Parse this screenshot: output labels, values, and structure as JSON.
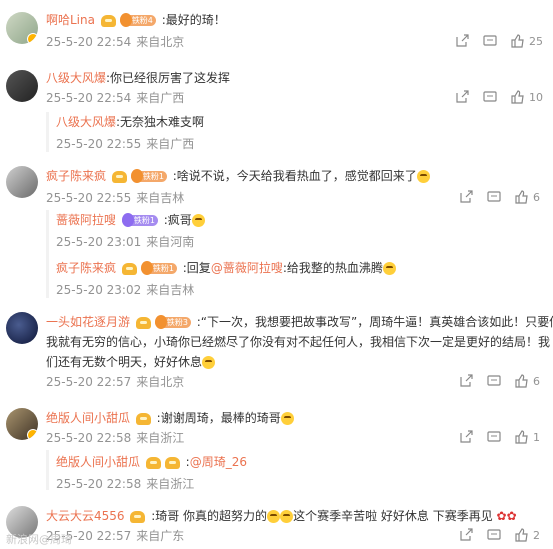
{
  "comments": [
    {
      "user": "啊哈Lina",
      "badge": "铁粉4",
      "text": ":最好的琦！",
      "date": "25-5-20 22:54",
      "loc": "来自北京",
      "likes": "25"
    },
    {
      "user": "八级大风爆",
      "text": ":你已经很厉害了这发挥",
      "date": "25-5-20 22:54",
      "loc": "来自广西",
      "likes": "10",
      "replies": [
        {
          "user": "八级大风爆",
          "text": ":无奈独木难支啊",
          "date": "25-5-20 22:55",
          "loc": "来自广西"
        }
      ]
    },
    {
      "user": "疯子陈来疯",
      "badge": "铁粉1",
      "text": ":啥说不说，今天给我看热血了，感觉都回来了",
      "date": "25-5-20 22:55",
      "loc": "来自吉林",
      "likes": "6",
      "replies": [
        {
          "user": "蔷薇阿拉嗖",
          "badge": "铁粉1",
          "text": ":疯哥",
          "date": "25-5-20 23:01",
          "loc": "来自河南"
        },
        {
          "user": "疯子陈来疯",
          "badge": "铁粉1",
          "text_pre": ":回复",
          "mention": "@蔷薇阿拉嗖",
          "text": ":给我整的热血沸腾",
          "date": "25-5-20 23:02",
          "loc": "来自吉林"
        }
      ]
    },
    {
      "user": "一头如花逐月游",
      "badge": "铁粉3",
      "text_line1": ":“下一次，我想要把故事改写”，周琦牛逼！真英雄合该如此！只要你在",
      "text_line2": "我就有无穷的信心，小琦你已经燃尽了你没有对不起任何人，我相信下次一定是更好的结局！我",
      "text_line3": "们还有无数个明天，好好休息",
      "date": "25-5-20 22:57",
      "loc": "来自北京",
      "likes": "6"
    },
    {
      "user": "绝版人间小甜瓜",
      "text": ":谢谢周琦，最棒的琦哥",
      "date": "25-5-20 22:58",
      "loc": "来自浙江",
      "likes": "1",
      "replies": [
        {
          "user": "绝版人间小甜瓜",
          "text_pre": ":",
          "mention": "@周琦_26",
          "text": "",
          "date": "25-5-20 22:58",
          "loc": "来自浙江"
        }
      ]
    },
    {
      "user": "大云大云4556",
      "text": ":琦哥 你真的超努力的",
      "text2": "这个赛季辛苦啦 好好休息 下赛季再见",
      "date": "25-5-20 22:57",
      "loc": "来自广东",
      "likes": "2"
    }
  ],
  "watermark": "新浪网@周琦",
  "colors": {
    "username": "#eb7350",
    "meta": "#939393",
    "text": "#333333"
  }
}
